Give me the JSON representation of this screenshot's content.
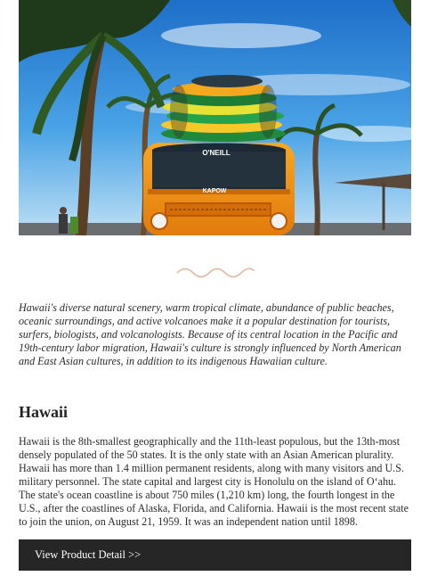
{
  "hero": {
    "image_name": "orange-van-with-surfboards-photo",
    "van_badge": "O'NEILL",
    "plate": "KAPOW"
  },
  "divider": {
    "icon": "wave-divider-icon",
    "color": "#e0b9a3"
  },
  "intro": {
    "text": "Hawaii's diverse natural scenery, warm tropical climate, abundance of public beaches, oceanic surroundings, and active volcanoes make it a popular destination for tourists, surfers, biologists, and volcanologists. Because of its central location in the Pacific and 19th-century labor migration, Hawaii's culture is strongly influenced by North American and East Asian cultures, in addition to its indigenous Hawaiian culture."
  },
  "article": {
    "title": "Hawaii",
    "body": "Hawaii is the 8th-smallest geographically and the 11th-least populous, but the 13th-most densely populated of the 50 states. It is the only state with an Asian American plurality. Hawaii has more than 1.4 million permanent residents, along with many visitors and U.S. military personnel. The state capital and largest city is Honolulu on the island of O‘ahu. The state's ocean coastline is about 750 miles (1,210 km) long, the fourth longest in the U.S., after the coastlines of Alaska, Florida, and California. Hawaii is the most recent state to join the union, on August 21, 1959. It was an independent nation until 1898."
  },
  "cta": {
    "label": "View Product Detail >>",
    "background": "#262626"
  }
}
